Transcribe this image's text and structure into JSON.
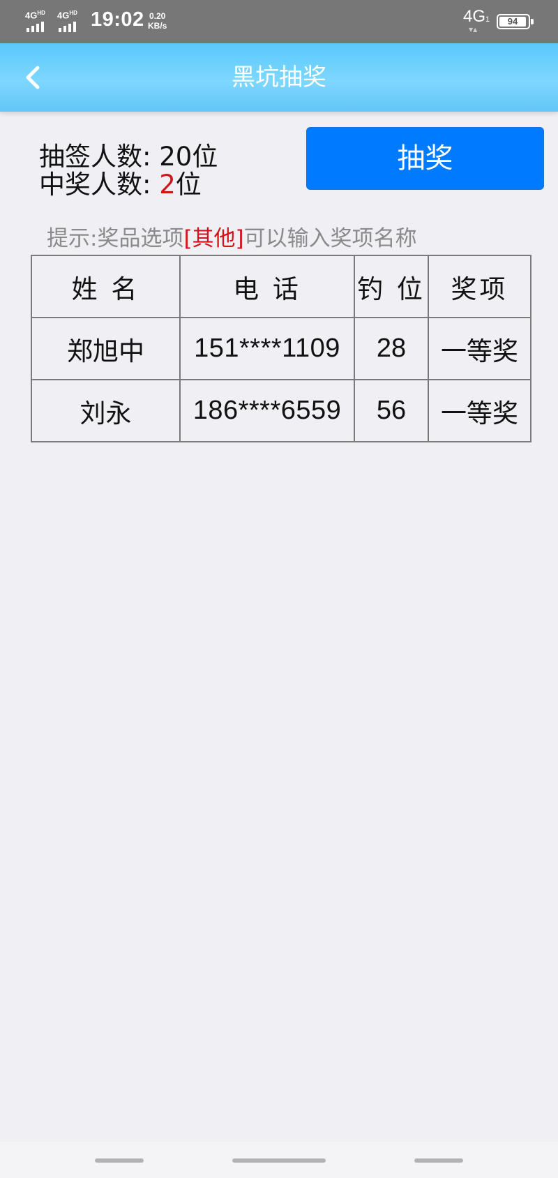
{
  "status_bar": {
    "signal1_label": "4G",
    "signal1_sup": "HD",
    "signal2_label": "4G",
    "signal2_sup": "HD",
    "time": "19:02",
    "speed_value": "0.20",
    "speed_unit": "KB/s",
    "network": "4G",
    "network_sub": "1",
    "battery": "94"
  },
  "header": {
    "back_icon": "chevron-left-icon",
    "title": "黑坑抽奖"
  },
  "summary": {
    "participants_label": "抽签人数: ",
    "participants_value": "20",
    "participants_unit": "位",
    "winners_label": "中奖人数: ",
    "winners_value": "2",
    "winners_unit": "位",
    "highlight_color": "#d0141b"
  },
  "draw_button": {
    "label": "抽奖",
    "color": "#007aff"
  },
  "hint": {
    "prefix": "提示:奖品选项",
    "highlight": "[其他]",
    "suffix": "可以输入奖项名称"
  },
  "table": {
    "headers": [
      "姓 名",
      "电 话",
      "钓 位",
      "奖项"
    ],
    "rows": [
      [
        "郑旭中",
        "151****1109",
        "28",
        "一等奖"
      ],
      [
        "刘永",
        "186****6559",
        "56",
        "一等奖"
      ]
    ]
  }
}
